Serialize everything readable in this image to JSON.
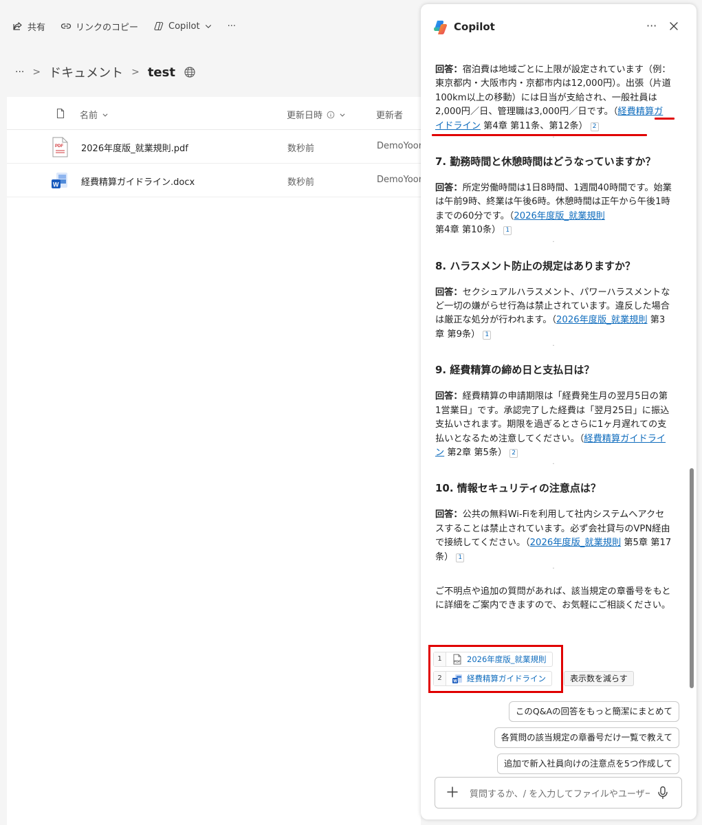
{
  "toolbar": {
    "share": "共有",
    "copy_link": "リンクのコピー",
    "copilot": "Copilot",
    "more": "···"
  },
  "breadcrumb": {
    "more": "···",
    "folder": "ドキュメント",
    "current": "test"
  },
  "list": {
    "columns": {
      "name": "名前",
      "modified": "更新日時",
      "modified_by": "更新者"
    },
    "rows": [
      {
        "name": "2026年度版_就業規則.pdf",
        "modified": "数秒前",
        "modified_by": "DemoYoon",
        "type": "pdf"
      },
      {
        "name": "経費精算ガイドライン.docx",
        "modified": "数秒前",
        "modified_by": "DemoYoon",
        "type": "docx"
      }
    ]
  },
  "copilot": {
    "title": "Copilot",
    "more": "···",
    "answer_label": "回答",
    "colon": "：",
    "a6": {
      "text": "宿泊費は地域ごとに上限が設定されています（例：東京都内・大阪市内・京都市内は12,000円）。出張（片道100km以上の移動）には日当が支給され、一般社員は2,000円／日、管理職は3,000円／日です。（",
      "link": "経費精算ガイドライン",
      "tail": " 第4章 第11条、第12条）",
      "ref": "2"
    },
    "q7": {
      "title": "7. 勤務時間と休憩時間はどうなっていますか？",
      "text": "所定労働時間は1日8時間、1週間40時間です。始業は午前9時、終業は午後6時。休憩時間は正午から午後1時までの60分です。（",
      "link": "2026年度版_就業規則",
      "tail": " 第4章 第10条）",
      "ref": "1"
    },
    "q8": {
      "title": "8. ハラスメント防止の規定はありますか？",
      "text": "セクシュアルハラスメント、パワーハラスメントなど一切の嫌がらせ行為は禁止されています。違反した場合は厳正な処分が行われます。（",
      "link": "2026年度版_就業規則",
      "tail": " 第3章 第9条）",
      "ref": "1"
    },
    "q9": {
      "title": "9. 経費精算の締め日と支払日は？",
      "text": "経費精算の申請期限は「経費発生月の翌月5日の第1営業日」です。承認完了した経費は「翌月25日」に振込支払いされます。期限を過ぎるとさらに1ヶ月遅れての支払いとなるため注意してください。（",
      "link": "経費精算ガイドライン",
      "tail": " 第2章 第5条）",
      "ref": "2"
    },
    "q10": {
      "title": "10. 情報セキュリティの注意点は？",
      "text": "公共の無料Wi-Fiを利用して社内システムへアクセスすることは禁止されています。必ず会社貸与のVPN経由で接続してください。（",
      "link": "2026年度版_就業規則",
      "tail": " 第5章 第17条）",
      "ref": "1"
    },
    "closing": "ご不明点や追加の質問があれば、該当規定の章番号をもとに詳細をご案内できますので、お気軽にご相談ください。",
    "references": [
      {
        "num": "1",
        "label": "2026年度版_就業規則",
        "icon": "pdf-icon"
      },
      {
        "num": "2",
        "label": "経費精算ガイドライン",
        "icon": "word-icon"
      }
    ],
    "reduce_label": "表示数を減らす",
    "suggestions": [
      "このQ&Aの回答をもっと簡潔にまとめて",
      "各質問の該当規定の章番号だけ一覧で教えて",
      "追加で新入社員向けの注意点を5つ作成して"
    ],
    "composer_placeholder": "質問するか、/ を入力してファイルやユーザーを参照します"
  },
  "colors": {
    "accent": "#0f6cbd",
    "highlight": "#e00000"
  }
}
